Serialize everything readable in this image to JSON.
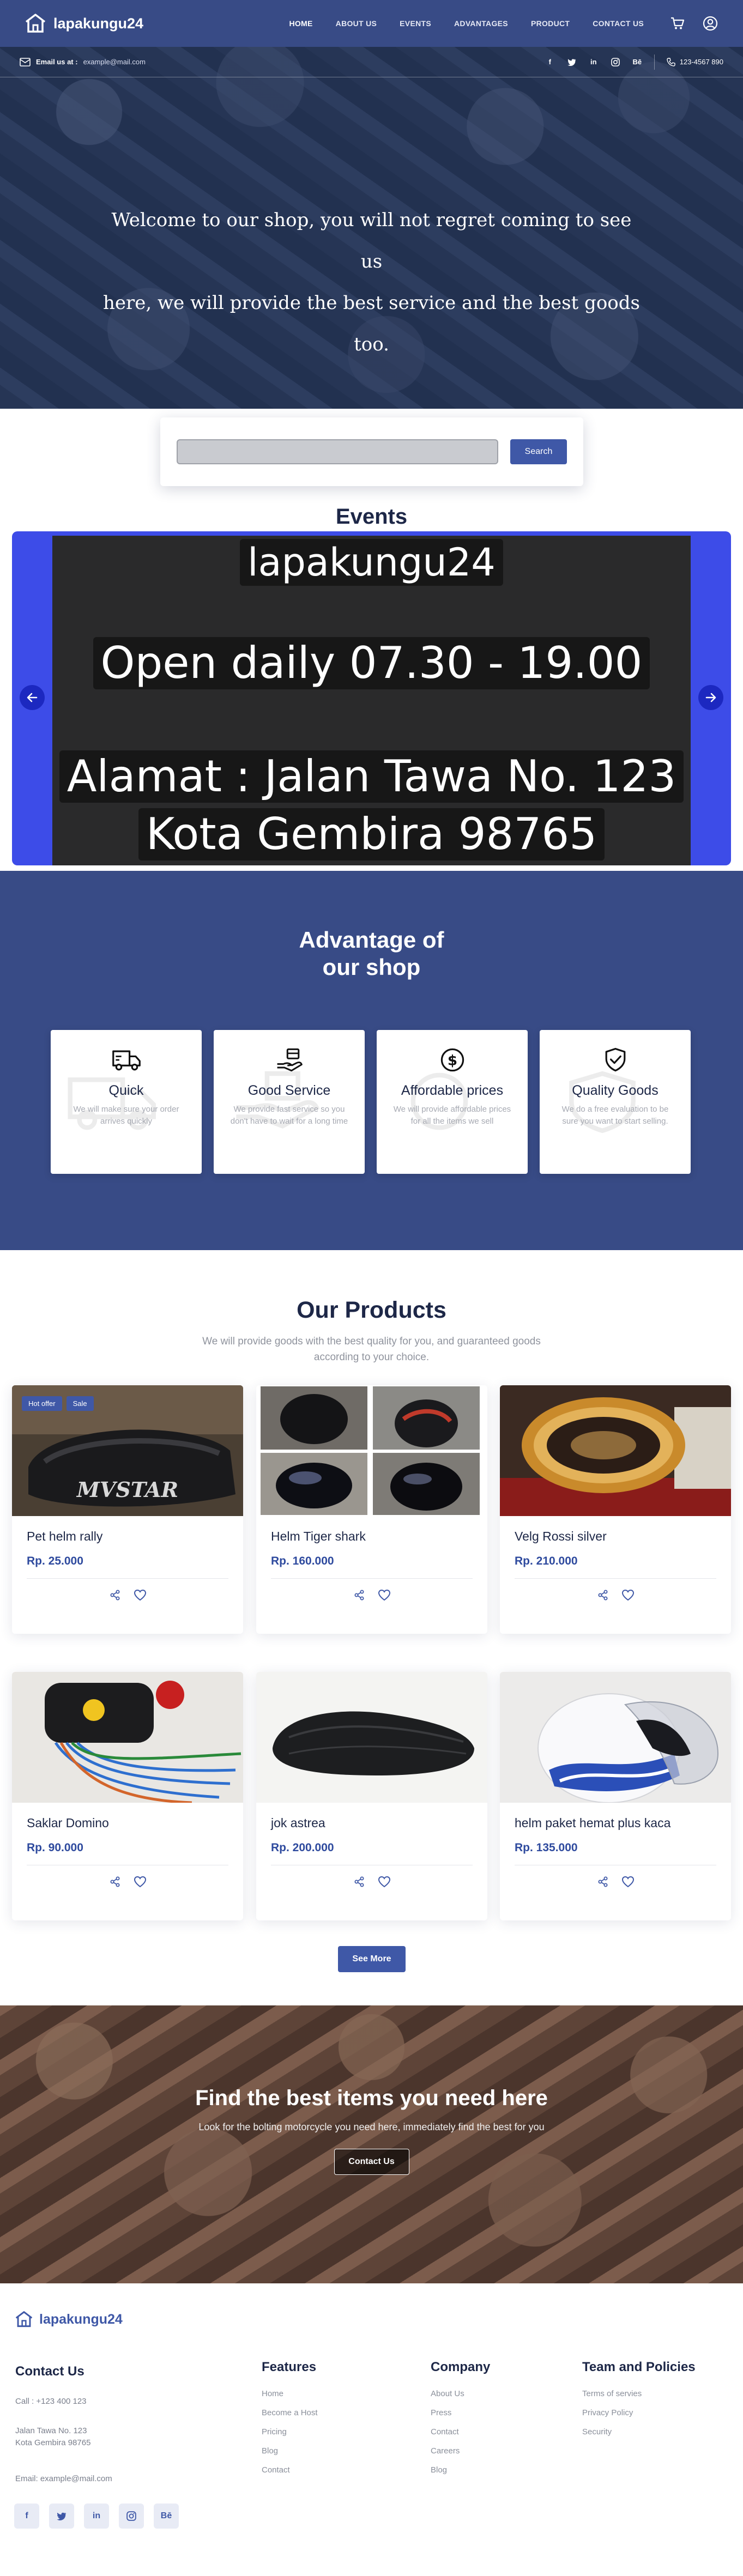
{
  "nav": {
    "brand": "lapakungu24",
    "links": [
      "HOME",
      "ABOUT US",
      "EVENTS",
      "ADVANTAGES",
      "PRODUCT",
      "CONTACT US"
    ],
    "active": "HOME",
    "icons": [
      "cart-icon",
      "user-icon"
    ]
  },
  "topbar": {
    "email_label": "Email us at :",
    "email_value": "example@mail.com",
    "socials": [
      "facebook-icon",
      "twitter-icon",
      "linkedin-icon",
      "instagram-icon",
      "behance-icon"
    ],
    "phone": "123-4567 890"
  },
  "hero": {
    "line1": "Welcome to our shop, you will not regret coming to see us",
    "line2": "here, we will provide the best service and the best goods too."
  },
  "search": {
    "button": "Search",
    "placeholder": ""
  },
  "events": {
    "title": "Events",
    "slide_lines": [
      "lapakungu24",
      "Open daily 07.30 - 19.00",
      "Alamat : Jalan Tawa No. 123",
      "Kota Gembira 98765"
    ]
  },
  "advantages": {
    "title_line1": "Advantage of",
    "title_line2": "our shop",
    "items": [
      {
        "icon": "truck-icon",
        "name": "Quick",
        "desc": "We will make sure your order arrives quickly"
      },
      {
        "icon": "hand-service-icon",
        "name": "Good Service",
        "desc": "We provide fast service so you don't have to wait for a long time"
      },
      {
        "icon": "dollar-icon",
        "name": "Affordable prices",
        "desc": "We will provide affordable prices for all the items we sell"
      },
      {
        "icon": "shield-check-icon",
        "name": "Quality Goods",
        "desc": "We do a free evaluation to be sure you want to start selling."
      }
    ]
  },
  "products": {
    "title": "Our Products",
    "subtitle": "We will provide goods with the best quality for you, and guaranteed goods according to your choice.",
    "items": [
      {
        "name": "Pet helm rally",
        "price": "Rp. 25.000",
        "tags": [
          "Hot offer",
          "Sale"
        ]
      },
      {
        "name": "Helm Tiger shark",
        "price": "Rp. 160.000",
        "tags": []
      },
      {
        "name": "Velg Rossi silver",
        "price": "Rp. 210.000",
        "tags": []
      },
      {
        "name": "Saklar Domino",
        "price": "Rp. 90.000",
        "tags": []
      },
      {
        "name": "jok astrea",
        "price": "Rp. 200.000",
        "tags": []
      },
      {
        "name": "helm paket hemat plus kaca",
        "price": "Rp. 135.000",
        "tags": []
      }
    ],
    "see_more": "See More",
    "product_image_label": "MVSTAR"
  },
  "cta": {
    "title": "Find the best items you need here",
    "text": "Look for the bolting motorcycle you need here, immediately find the best for you",
    "button": "Contact Us"
  },
  "footer": {
    "brand": "lapakungu24",
    "contact_title": "Contact Us",
    "call": "Call : +123 400 123",
    "address1": "Jalan Tawa No. 123",
    "address2": "Kota Gembira 98765",
    "email": "Email: example@mail.com",
    "columns": [
      {
        "title": "Features",
        "links": [
          "Home",
          "Become a Host",
          "Pricing",
          "Blog",
          "Contact"
        ]
      },
      {
        "title": "Company",
        "links": [
          "About Us",
          "Press",
          "Contact",
          "Careers",
          "Blog"
        ]
      },
      {
        "title": "Team and Policies",
        "links": [
          "Terms of servies",
          "Privacy Policy",
          "Security"
        ]
      }
    ],
    "socials": [
      "facebook-icon",
      "twitter-icon",
      "linkedin-icon",
      "instagram-icon",
      "behance-icon"
    ]
  },
  "colors": {
    "primary": "#384b86",
    "accent": "#3f58a7",
    "carousel": "#3d4ce8",
    "heading": "#1d2747"
  }
}
